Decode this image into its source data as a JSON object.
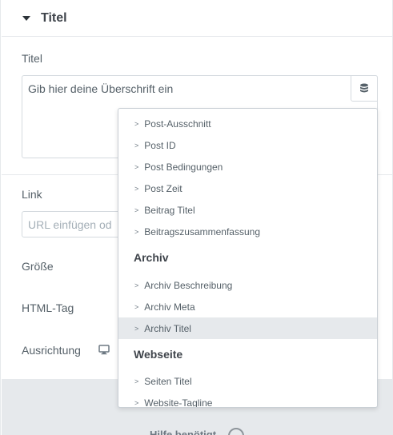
{
  "section": {
    "title": "Titel"
  },
  "title_field": {
    "label": "Titel",
    "value": "Gib hier deine Überschrift ein",
    "dynamic_icon": "database-icon"
  },
  "link_field": {
    "label": "Link",
    "placeholder": "URL einfügen od"
  },
  "size_field": {
    "label": "Größe"
  },
  "html_tag_field": {
    "label": "HTML-Tag"
  },
  "alignment_field": {
    "label": "Ausrichtung",
    "device_icon": "desktop-icon"
  },
  "footer": {
    "help_text": "Hilfe benötigt"
  },
  "dropdown": {
    "items_top": [
      "Post-Ausschnitt",
      "Post ID",
      "Post Bedingungen",
      "Post Zeit",
      "Beitrag Titel",
      "Beitragszusammenfassung"
    ],
    "group_archive": "Archiv",
    "items_archive": [
      "Archiv Beschreibung",
      "Archiv Meta",
      "Archiv Titel"
    ],
    "selected_item": "Archiv Titel",
    "group_site": "Webseite",
    "items_site": [
      "Seiten Titel",
      "Website-Tagline"
    ],
    "chevron": ">"
  },
  "colors": {
    "text": "#556068",
    "heading": "#3f444b",
    "border": "#d5dadf",
    "selected_bg": "#e6e9ec",
    "footer_bg": "#e6e9ec"
  }
}
